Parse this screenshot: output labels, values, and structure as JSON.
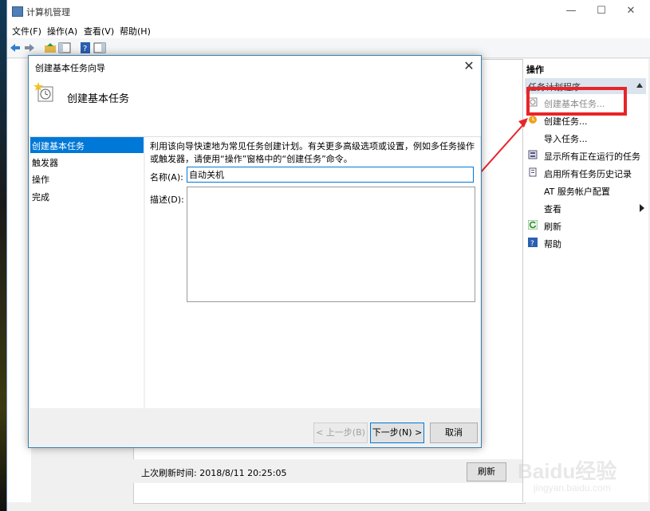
{
  "window": {
    "title": "计算机管理",
    "controls": {
      "minimize": "—",
      "maximize": "☐",
      "close": "✕"
    }
  },
  "menu": [
    "文件(F)",
    "操作(A)",
    "查看(V)",
    "帮助(H)"
  ],
  "background": {
    "refresh_time_text": "上次刷新时间: 2018/8/11 20:25:05",
    "refresh_button": "刷新"
  },
  "actions_pane": {
    "header": "操作",
    "section": "任务计划程序",
    "items": [
      {
        "label": "创建基本任务...",
        "icon": "create-basic-task-icon",
        "disabled": true
      },
      {
        "label": "创建任务...",
        "icon": "create-task-icon",
        "disabled": false
      },
      {
        "label": "导入任务...",
        "icon": "",
        "disabled": false
      },
      {
        "label": "显示所有正在运行的任务",
        "icon": "running-tasks-icon",
        "disabled": false
      },
      {
        "label": "启用所有任务历史记录",
        "icon": "history-icon",
        "disabled": false
      },
      {
        "label": "AT 服务帐户配置",
        "icon": "",
        "disabled": false
      },
      {
        "label": "查看",
        "icon": "",
        "disabled": false,
        "submenu": true
      },
      {
        "label": "刷新",
        "icon": "refresh-icon",
        "disabled": false
      },
      {
        "label": "帮助",
        "icon": "help-icon",
        "disabled": false
      }
    ],
    "highlight_color": "#e8242a"
  },
  "wizard": {
    "title": "创建基本任务向导",
    "header_title": "创建基本任务",
    "steps": [
      {
        "label": "创建基本任务",
        "active": true
      },
      {
        "label": "触发器",
        "active": false
      },
      {
        "label": "操作",
        "active": false
      },
      {
        "label": "完成",
        "active": false
      }
    ],
    "description": "利用该向导快速地为常见任务创建计划。有关更多高级选项或设置，例如多任务操作或触发器，请使用“操作”窗格中的“创建任务”命令。",
    "name_label": "名称(A):",
    "name_value": "自动关机",
    "desc_label": "描述(D):",
    "desc_value": "",
    "buttons": {
      "back": "< 上一步(B)",
      "next": "下一步(N) >",
      "cancel": "取消"
    },
    "accent_color": "#0078d7"
  },
  "watermark": {
    "brand": "Baidu经验",
    "url": "jingyan.baidu.com"
  }
}
